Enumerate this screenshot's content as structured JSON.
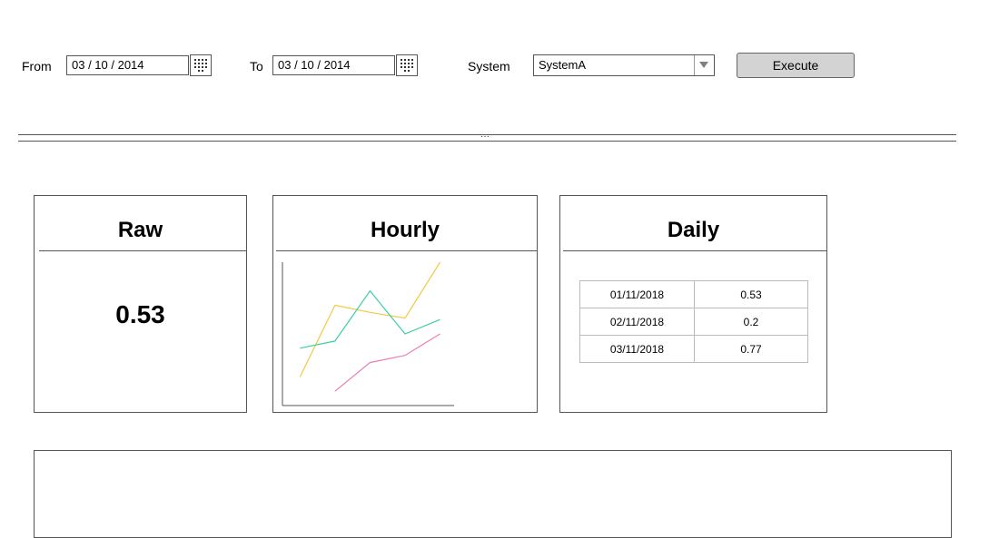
{
  "filters": {
    "from_label": "From",
    "from_value": "03 / 10 / 2014",
    "to_label": "To",
    "to_value": "03 / 10 / 2014",
    "system_label": "System",
    "system_selected": "SystemA",
    "execute_label": "Execute"
  },
  "splitter": {
    "grip": "···"
  },
  "raw": {
    "title": "Raw",
    "value": "0.53"
  },
  "hourly": {
    "title": "Hourly",
    "chart_data": {
      "type": "line",
      "title": "",
      "xlabel": "",
      "ylabel": "",
      "x": [
        0,
        1,
        2,
        3,
        4
      ],
      "xlim": [
        -0.5,
        4.4
      ],
      "ylim": [
        0,
        100
      ],
      "grid": false,
      "series": [
        {
          "color": "#f5c842",
          "values": [
            20,
            70,
            65,
            61,
            100
          ]
        },
        {
          "color": "#3fcfa8",
          "values": [
            40,
            45,
            80,
            50,
            60
          ]
        },
        {
          "color": "#e880b8",
          "values": [
            null,
            10,
            30,
            35,
            50
          ]
        }
      ]
    }
  },
  "daily": {
    "title": "Daily",
    "rows": [
      {
        "date": "01/11/2018",
        "value": "0.53"
      },
      {
        "date": "02/11/2018",
        "value": "0.2"
      },
      {
        "date": "03/11/2018",
        "value": "0.77"
      }
    ]
  },
  "icons": {
    "calendar": "calendar-icon",
    "dropdown": "chevron-down-icon",
    "arrow_color": "#808080"
  }
}
